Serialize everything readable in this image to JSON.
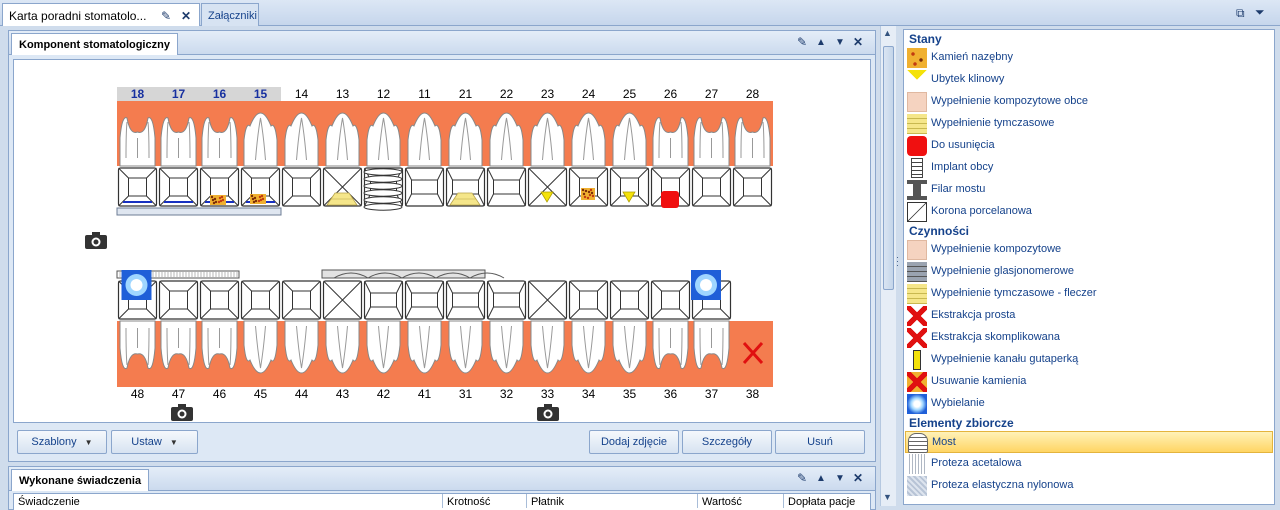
{
  "tabs": {
    "karta": "Karta  poradni stomatolo...",
    "zalaczniki": "Załączniki"
  },
  "component_panel": {
    "title": "Komponent stomatologiczny"
  },
  "teeth": {
    "upper_numbers": [
      "18",
      "17",
      "16",
      "15",
      "14",
      "13",
      "12",
      "11",
      "21",
      "22",
      "23",
      "24",
      "25",
      "26",
      "27",
      "28"
    ],
    "lower_numbers": [
      "48",
      "47",
      "46",
      "45",
      "44",
      "43",
      "42",
      "41",
      "31",
      "32",
      "33",
      "34",
      "35",
      "36",
      "37",
      "38"
    ],
    "upper_highlighted": [
      "18",
      "17",
      "16",
      "15"
    ]
  },
  "buttons": {
    "szablony": "Szablony",
    "ustaw": "Ustaw",
    "dodaj_zdjecie": "Dodaj zdjęcie",
    "szczegoly": "Szczegóły",
    "usun": "Usuń"
  },
  "services_panel": {
    "title": "Wykonane świadczenia",
    "columns": [
      "Świadczenie",
      "Krotność",
      "Płatnik",
      "Wartość",
      "Dopłata pacje"
    ]
  },
  "legend": {
    "groups": {
      "stany": "Stany",
      "czynnosci": "Czynności",
      "elementy": "Elementy zbiorcze"
    },
    "stany": [
      "Kamień nazębny",
      "Ubytek klinowy",
      "Wypełnienie kompozytowe obce",
      "Wypełnienie tymczasowe",
      "Do usunięcia",
      "Implant obcy",
      "Filar mostu",
      "Korona porcelanowa"
    ],
    "czynnosci": [
      "Wypełnienie kompozytowe",
      "Wypełnienie glasjonomerowe",
      "Wypełnienie tymczasowe - fleczer",
      "Ekstrakcja prosta",
      "Ekstrakcja skomplikowana",
      "Wypełnienie kanału gutaperką",
      "Usuwanie kamienia",
      "Wybielanie"
    ],
    "elementy": [
      "Most",
      "Proteza acetalowa",
      "Proteza elastyczna nylonowa"
    ],
    "selected": "Most"
  },
  "colors": {
    "gum": "#f47c4f",
    "selection": "#ffd564",
    "accent": "#15428b"
  }
}
